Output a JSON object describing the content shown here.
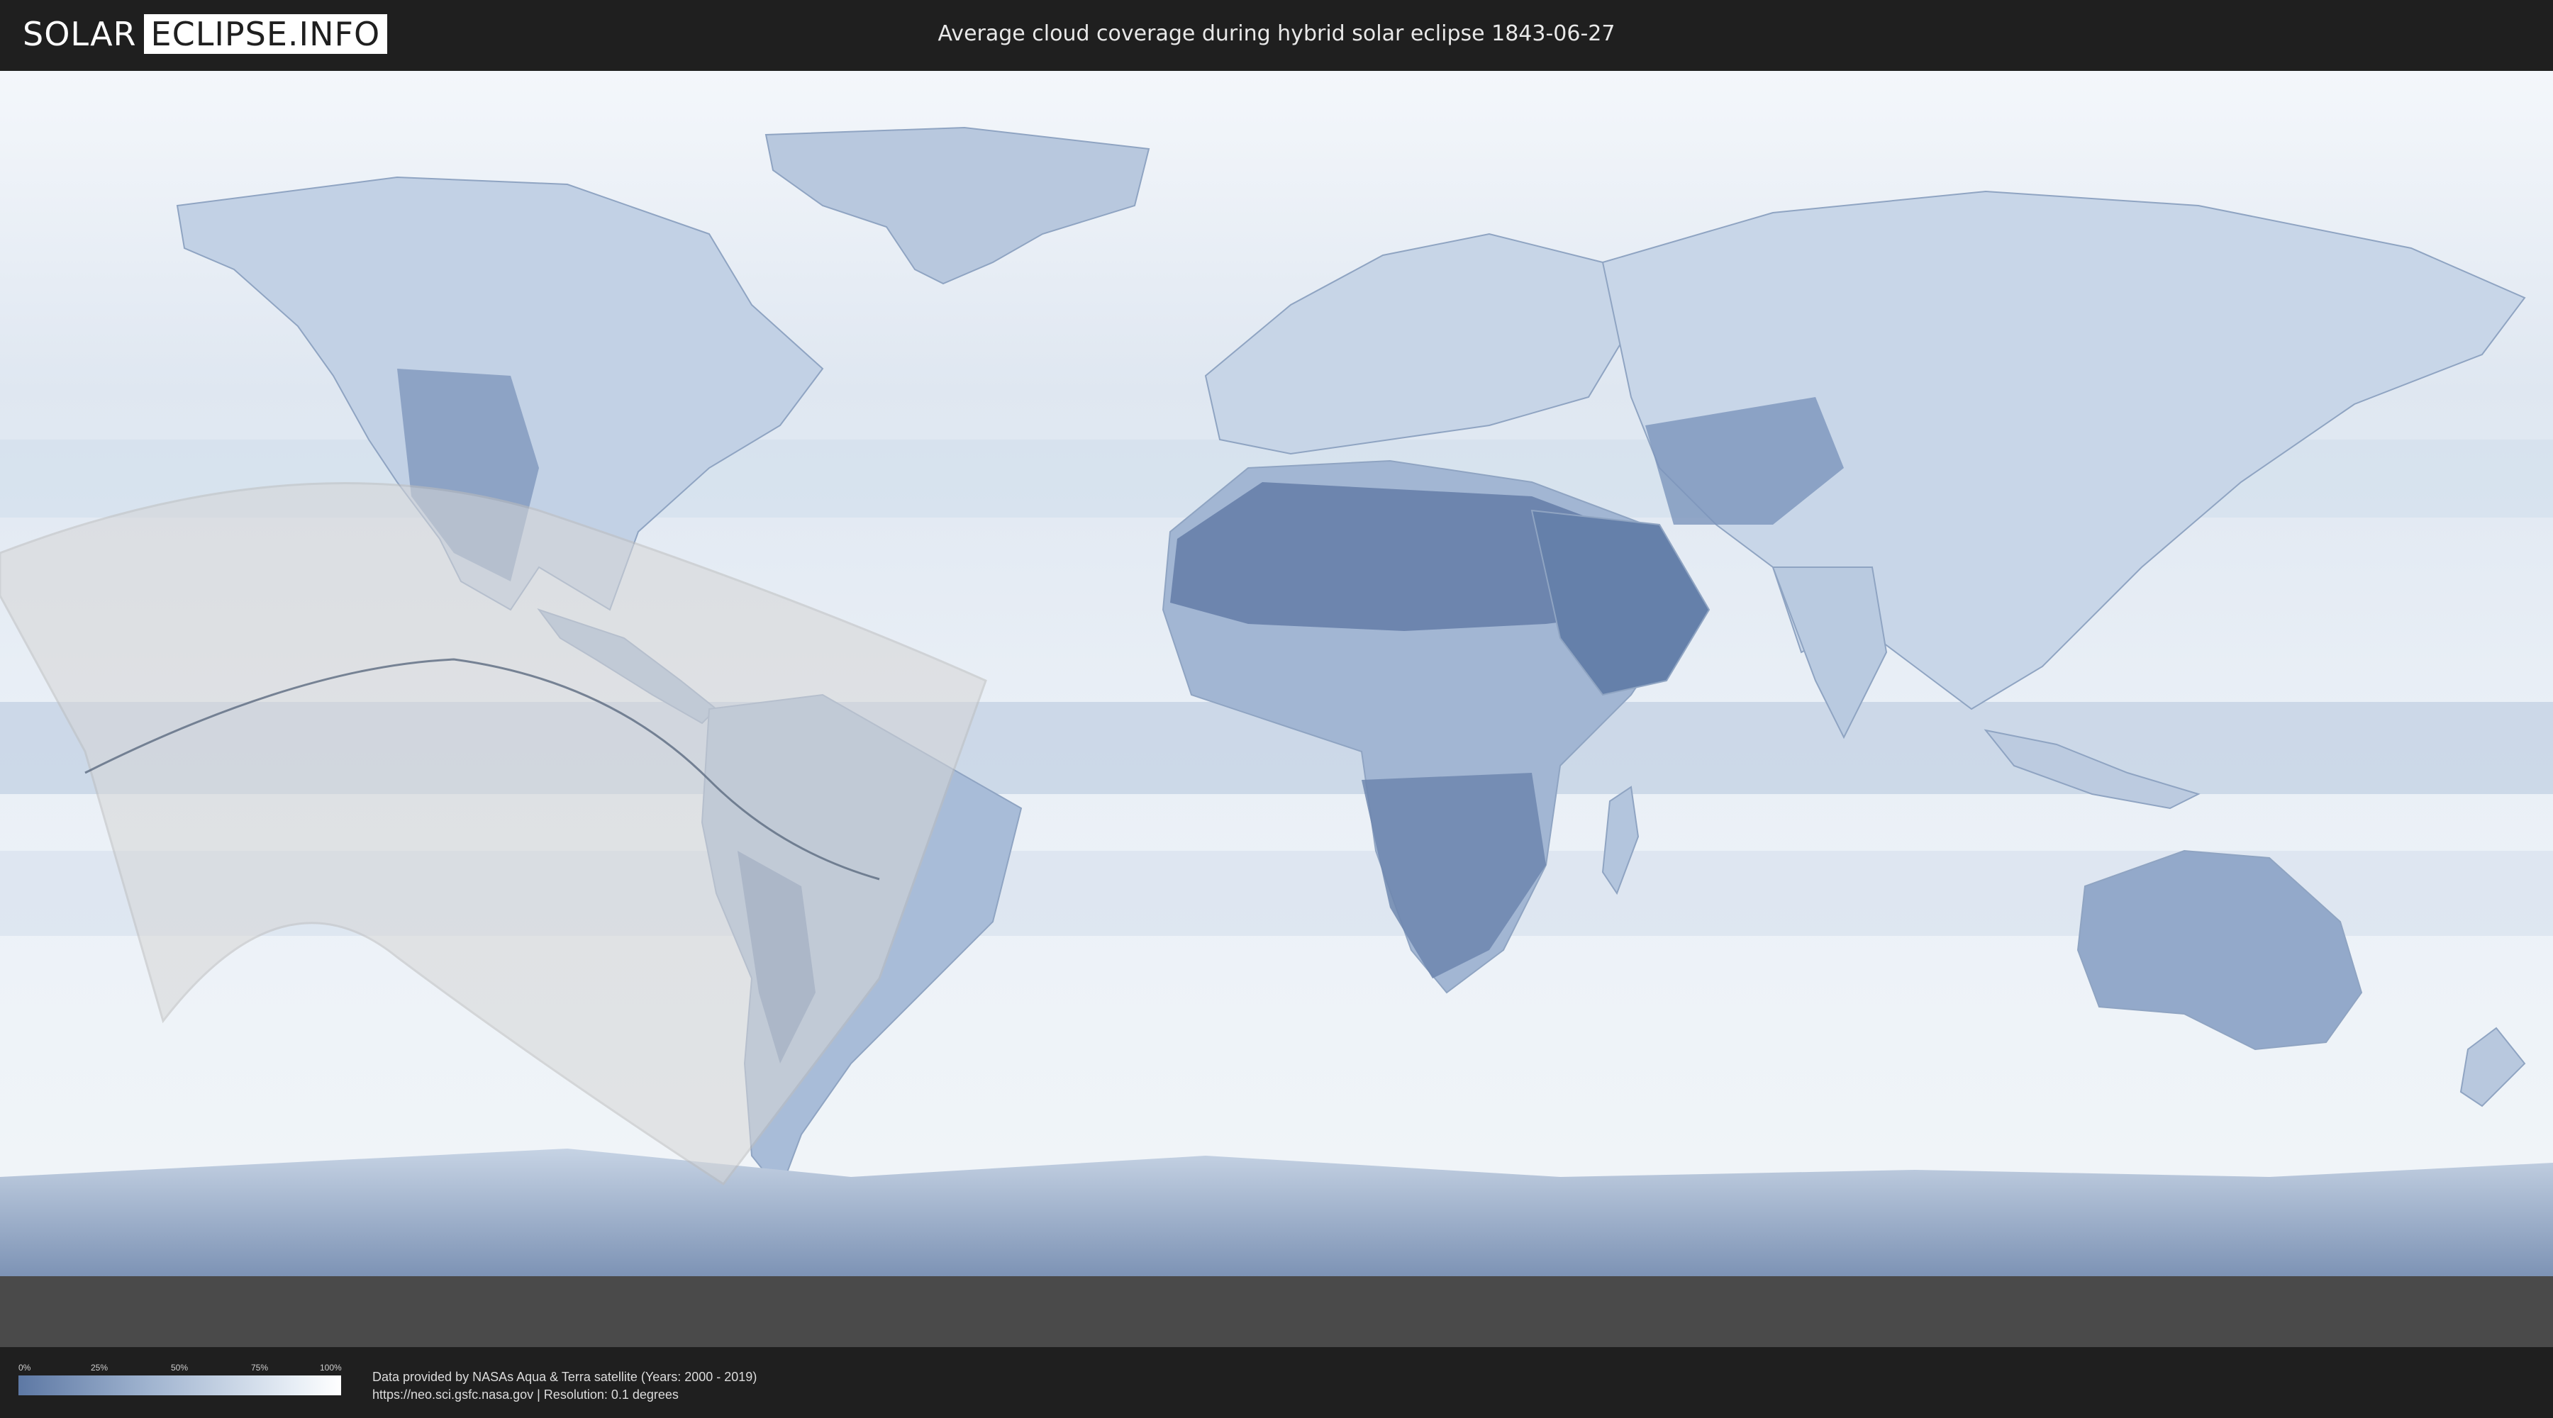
{
  "header": {
    "logo_left": "SOLAR",
    "logo_right": "ECLIPSE.INFO",
    "title": "Average cloud coverage during hybrid solar eclipse 1843-06-27"
  },
  "legend": {
    "ticks": [
      "0%",
      "25%",
      "50%",
      "75%",
      "100%"
    ],
    "colors": {
      "low": "#5d78a4",
      "high": "#ffffff"
    }
  },
  "footer": {
    "source_line1": "Data provided by NASAs Aqua & Terra satellite (Years: 2000 - 2019)",
    "source_line2": "https://neo.sci.gsfc.nasa.gov | Resolution: 0.1 degrees"
  },
  "map": {
    "ocean_color": "#e9eff6",
    "cloud_clear_color": "#5d78a4",
    "overlay_color": "#d6d6d6",
    "bottom_band_color": "#4a4a4a"
  }
}
